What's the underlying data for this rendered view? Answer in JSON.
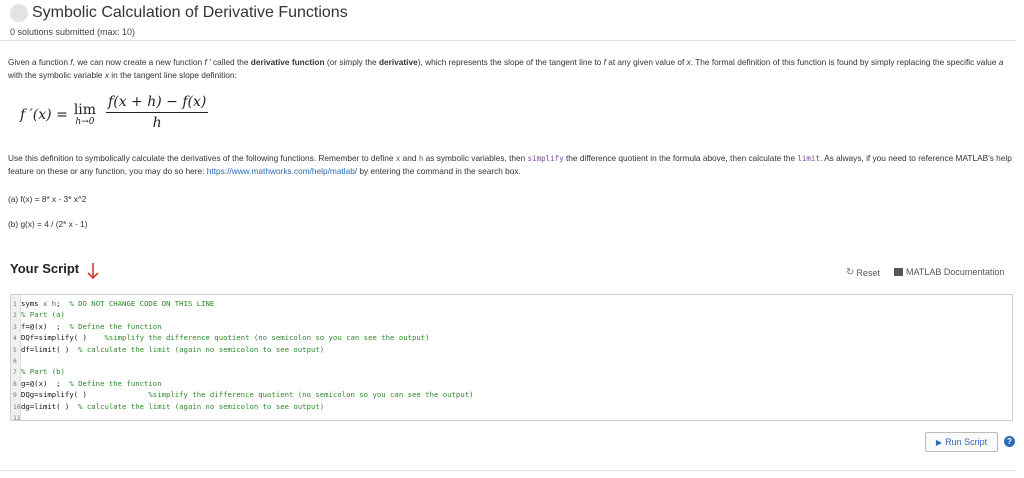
{
  "header": {
    "title": "Symbolic Calculation of Derivative Functions",
    "subtitle": "0 solutions submitted (max: 10)"
  },
  "description": {
    "p1": "Given a function ",
    "p1_f": "f",
    "p2": ", we can now create a new function ",
    "p2_fp": "f ′",
    "p3": " called the ",
    "p3_b1": "derivative function",
    "p4": " (or simply the ",
    "p4_b2": "derivative",
    "p5": "), which represents the slope of the tangent line to ",
    "p5_f": "f",
    "p6": " at any given value of ",
    "p6_x": "x",
    "p7": ". The formal definition of this function is found by simply replacing the specific value ",
    "p7_a": "a",
    "p8": " with the symbolic variable ",
    "p8_x": "x",
    "p9": " in the tangent line slope definition:"
  },
  "formula": {
    "lhs": "f ′(x) =",
    "lim": "lim",
    "lim_sub": "h→0",
    "numerator": "f(x + h) − f(x)",
    "denominator": "h"
  },
  "instructions": {
    "t1": "Use this definition to symbolically calculate the derivatives of the following functions. Remember to define ",
    "c1": "x",
    "t2": " and ",
    "c2": "h",
    "t3": " as symbolic variables, then ",
    "c3": "simplify",
    "t4": " the difference quotient in the formula above, then calculate the ",
    "c4": "limit",
    "t5": ". As always, if you need to reference MATLAB's help feature on these or any function, you may do so here: ",
    "link": "https://www.mathworks.com/help/matlab/",
    "t6": " by entering the command in the search box."
  },
  "parts": {
    "a": "(a) f(x) = 8* x - 3* x^2",
    "b": "(b) g(x) = 4 / (2* x - 1)"
  },
  "script": {
    "heading": "Your Script",
    "reset_label": "Reset",
    "docs_label": "MATLAB Documentation",
    "lines": [
      {
        "n": "1",
        "code": "syms ",
        "sym": "x h",
        "rest": ";  ",
        "comment": "% DO NOT CHANGE CODE ON THIS LINE"
      },
      {
        "n": "2",
        "code": "",
        "sym": "",
        "rest": "",
        "comment": "% Part (a)"
      },
      {
        "n": "3",
        "code": "f=@(x)  ;  ",
        "sym": "",
        "rest": "",
        "comment": "% Define the function"
      },
      {
        "n": "4",
        "code": "DQf=simplify( )    ",
        "sym": "",
        "rest": "",
        "comment": "%simplify the difference quotient (no semicolon so you can see the output)"
      },
      {
        "n": "5",
        "code": "df=limit( )  ",
        "sym": "",
        "rest": "",
        "comment": "% calculate the limit (again no semicolon to see output)"
      },
      {
        "n": "6",
        "code": "",
        "sym": "",
        "rest": "",
        "comment": ""
      },
      {
        "n": "7",
        "code": "",
        "sym": "",
        "rest": "",
        "comment": "% Part (b)"
      },
      {
        "n": "8",
        "code": "g=@(x)  ;  ",
        "sym": "",
        "rest": "",
        "comment": "% Define the function"
      },
      {
        "n": "9",
        "code": "DQg=simplify( )              ",
        "sym": "",
        "rest": "",
        "comment": "%simplify the difference quotient (no semicolon so you can see the output)"
      },
      {
        "n": "10",
        "code": "dg=limit( )  ",
        "sym": "",
        "rest": "",
        "comment": "% calculate the limit (again no semicolon to see output)"
      },
      {
        "n": "11",
        "code": "",
        "sym": "",
        "rest": "",
        "comment": ""
      }
    ]
  },
  "run": {
    "label": "Run Script",
    "help": "?"
  },
  "colors": {
    "link": "#2a6ab7",
    "arrow": "#d9382c",
    "comment": "#2a8a2a"
  }
}
